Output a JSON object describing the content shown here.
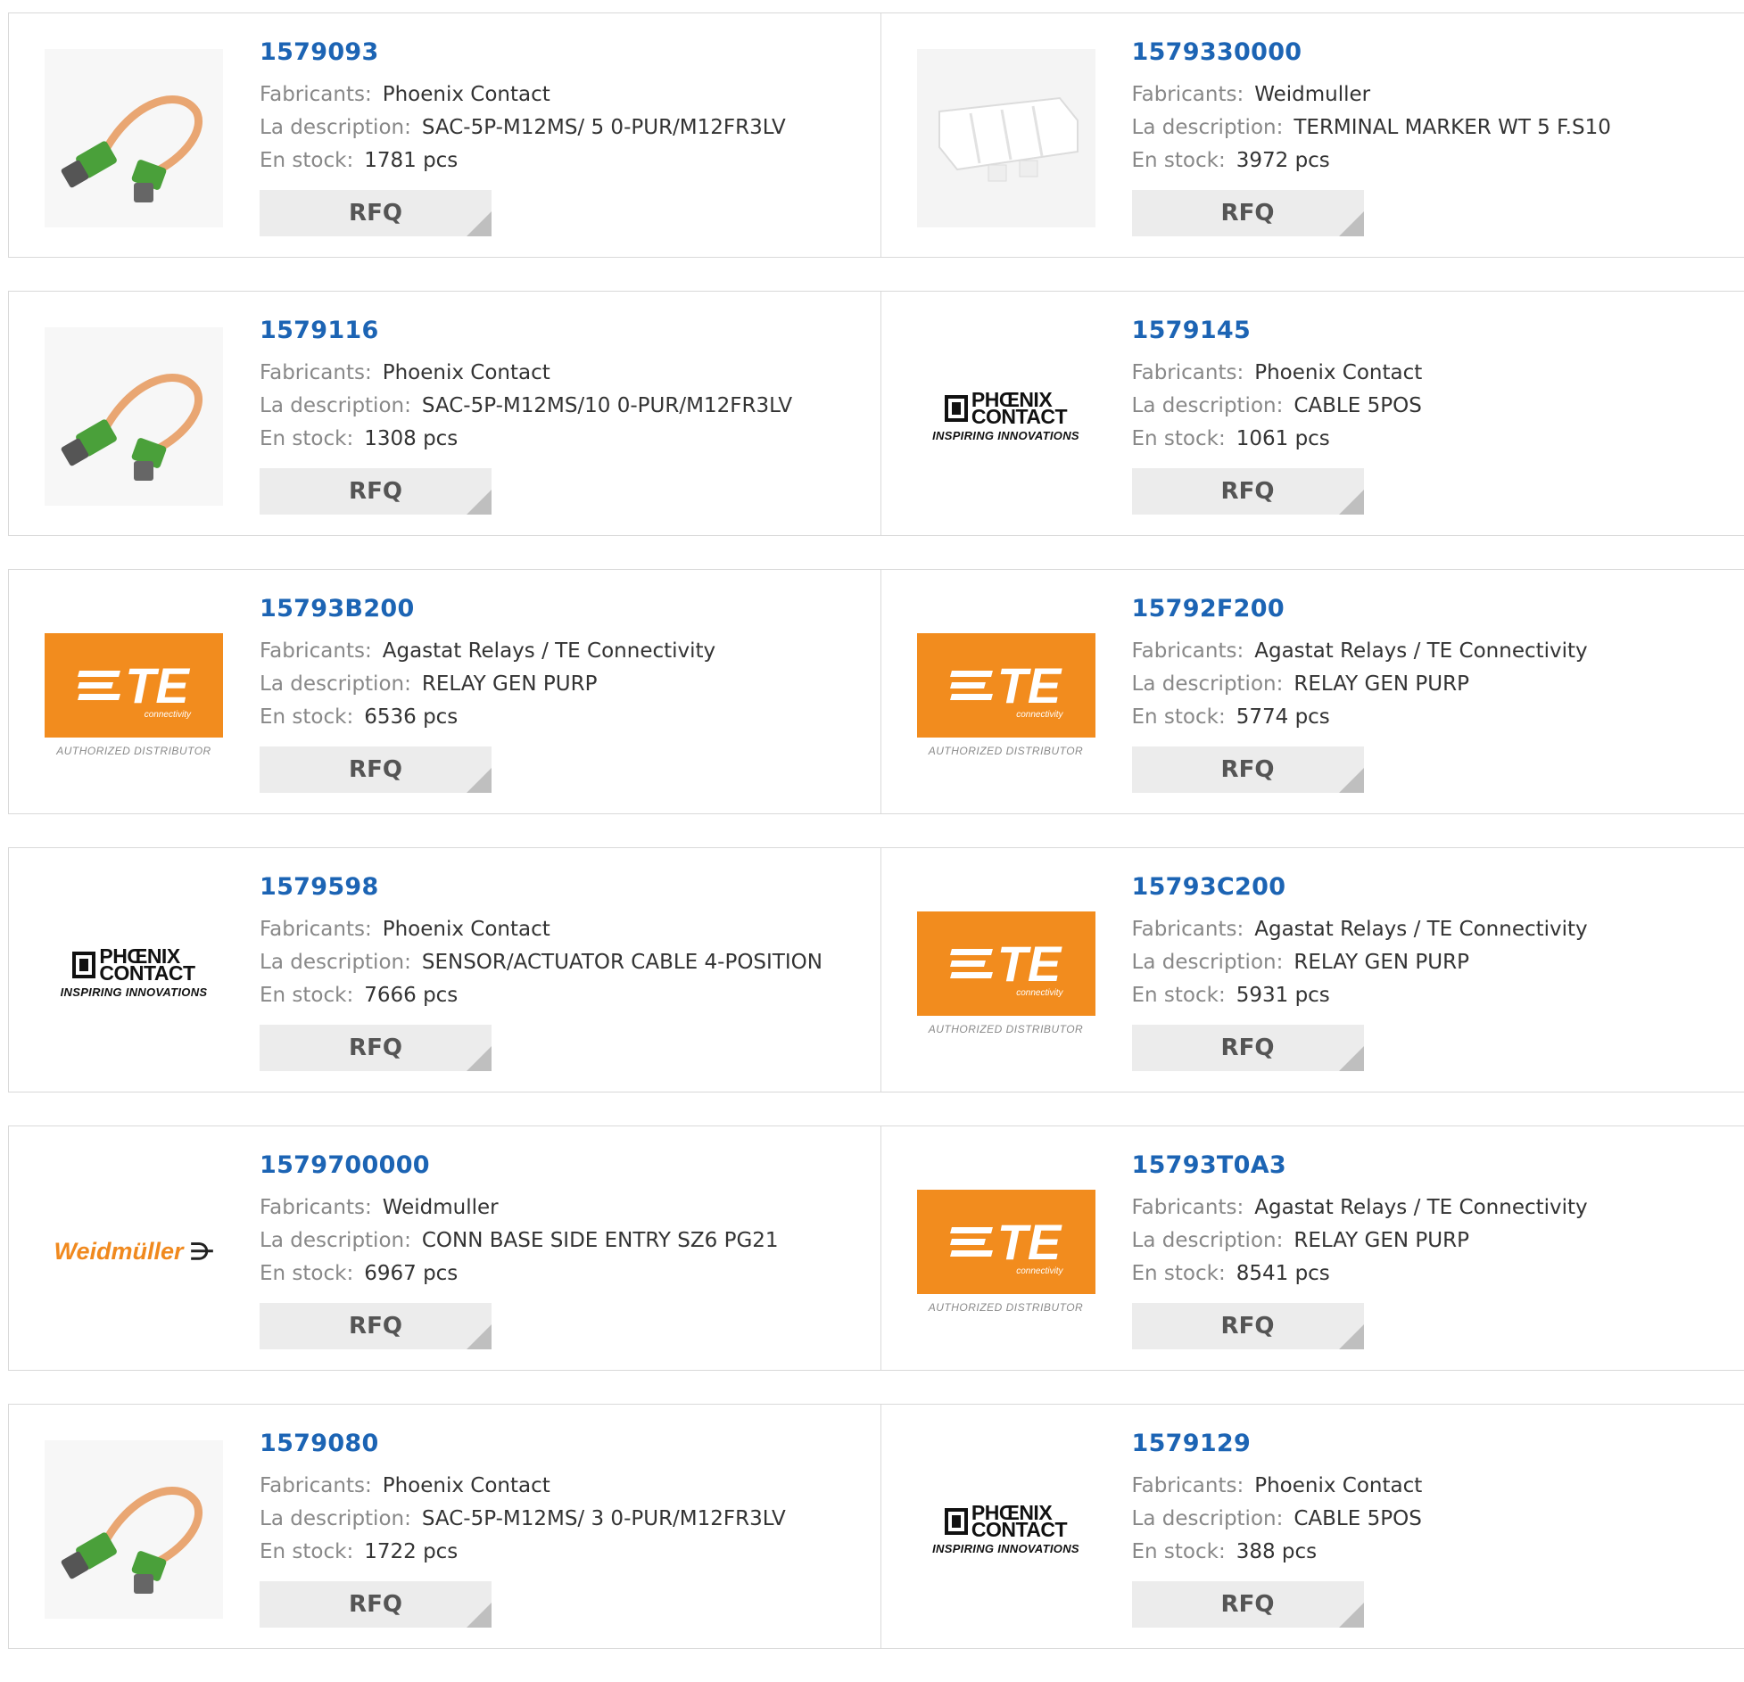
{
  "labels": {
    "manufacturer": "Fabricants:",
    "description": "La description:",
    "stock": "En stock:",
    "rfq": "RFQ"
  },
  "products": [
    {
      "part": "1579093",
      "manufacturer": "Phoenix Contact",
      "description": "SAC-5P-M12MS/ 5 0-PUR/M12FR3LV",
      "stock": "1781 pcs",
      "image": "cable-photo"
    },
    {
      "part": "1579330000",
      "manufacturer": "Weidmuller",
      "description": "TERMINAL MARKER WT 5 F.S10",
      "stock": "3972 pcs",
      "image": "terminal-marker-photo"
    },
    {
      "part": "1579116",
      "manufacturer": "Phoenix Contact",
      "description": "SAC-5P-M12MS/10 0-PUR/M12FR3LV",
      "stock": "1308 pcs",
      "image": "cable-photo"
    },
    {
      "part": "1579145",
      "manufacturer": "Phoenix Contact",
      "description": "CABLE 5POS",
      "stock": "1061 pcs",
      "image": "phoenix-logo"
    },
    {
      "part": "15793B200",
      "manufacturer": "Agastat Relays / TE Connectivity",
      "description": "RELAY GEN PURP",
      "stock": "6536 pcs",
      "image": "te-logo"
    },
    {
      "part": "15792F200",
      "manufacturer": "Agastat Relays / TE Connectivity",
      "description": "RELAY GEN PURP",
      "stock": "5774 pcs",
      "image": "te-logo"
    },
    {
      "part": "1579598",
      "manufacturer": "Phoenix Contact",
      "description": "SENSOR/ACTUATOR CABLE 4-POSITION",
      "stock": "7666 pcs",
      "image": "phoenix-logo"
    },
    {
      "part": "15793C200",
      "manufacturer": "Agastat Relays / TE Connectivity",
      "description": "RELAY GEN PURP",
      "stock": "5931 pcs",
      "image": "te-logo"
    },
    {
      "part": "1579700000",
      "manufacturer": "Weidmuller",
      "description": "CONN BASE SIDE ENTRY SZ6 PG21",
      "stock": "6967 pcs",
      "image": "weidmuller-logo"
    },
    {
      "part": "15793T0A3",
      "manufacturer": "Agastat Relays / TE Connectivity",
      "description": "RELAY GEN PURP",
      "stock": "8541 pcs",
      "image": "te-logo"
    },
    {
      "part": "1579080",
      "manufacturer": "Phoenix Contact",
      "description": "SAC-5P-M12MS/ 3 0-PUR/M12FR3LV",
      "stock": "1722 pcs",
      "image": "cable-photo"
    },
    {
      "part": "1579129",
      "manufacturer": "Phoenix Contact",
      "description": "CABLE 5POS",
      "stock": "388 pcs",
      "image": "phoenix-logo"
    }
  ],
  "logos": {
    "te": {
      "mark": "TE",
      "sub": "connectivity",
      "tagline": "AUTHORIZED DISTRIBUTOR"
    },
    "phoenix": {
      "line1": "PHŒNIX",
      "line2": "CONTACT",
      "tagline": "INSPIRING INNOVATIONS"
    },
    "weidmuller": {
      "name": "Weidmüller",
      "symbol": "⋺"
    }
  },
  "colors": {
    "part_link": "#1c64b4",
    "te_orange": "#f28c1e",
    "weidmuller_orange": "#f0891e",
    "rfq_bg": "#ececec"
  }
}
